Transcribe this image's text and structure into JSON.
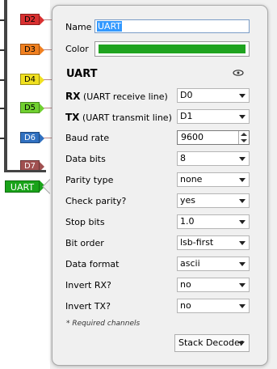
{
  "channels": [
    {
      "label": "D2",
      "color": "#d93030"
    },
    {
      "label": "D3",
      "color": "#f08020"
    },
    {
      "label": "D4",
      "color": "#f0e020"
    },
    {
      "label": "D5",
      "color": "#70d030"
    },
    {
      "label": "D6",
      "color": "#3070c0"
    },
    {
      "label": "D7",
      "color": "#a05050"
    }
  ],
  "analyzer_tag": "UART",
  "panel": {
    "name_label": "Name",
    "name_value": "UART",
    "color_label": "Color",
    "color_value": "#1fa31f",
    "title": "UART",
    "eye_icon": "eye-icon",
    "rx_label_bold": "RX",
    "rx_label_rest": "(UART receive line)",
    "rx_value": "D0",
    "tx_label_bold": "TX",
    "tx_label_rest": "(UART transmit line)",
    "tx_value": "D1",
    "settings": [
      {
        "label": "Baud rate",
        "value": "9600",
        "kind": "spin"
      },
      {
        "label": "Data bits",
        "value": "8",
        "kind": "select"
      },
      {
        "label": "Parity type",
        "value": "none",
        "kind": "select"
      },
      {
        "label": "Check parity?",
        "value": "yes",
        "kind": "select"
      },
      {
        "label": "Stop bits",
        "value": "1.0",
        "kind": "select"
      },
      {
        "label": "Bit order",
        "value": "lsb-first",
        "kind": "select"
      },
      {
        "label": "Data format",
        "value": "ascii",
        "kind": "select"
      },
      {
        "label": "Invert RX?",
        "value": "no",
        "kind": "select"
      },
      {
        "label": "Invert TX?",
        "value": "no",
        "kind": "select"
      }
    ],
    "required_note": "* Required channels",
    "stack_button": "Stack Decoder"
  }
}
